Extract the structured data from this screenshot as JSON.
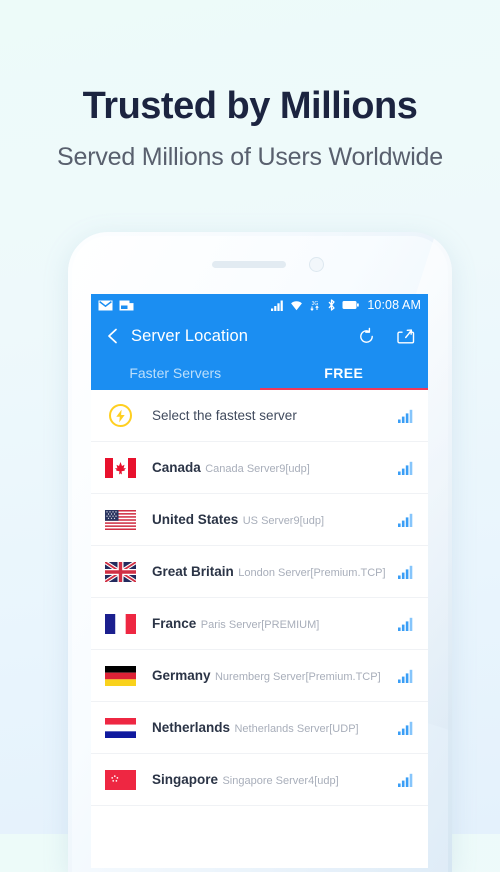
{
  "promo": {
    "title": "Trusted by Millions",
    "subtitle": "Served Millions of Users Worldwide"
  },
  "colors": {
    "accent": "#1b8ef2",
    "tab_underline": "#f0395a",
    "bolt": "#ffcf20",
    "signal": "#2b95f5",
    "title_text": "#1c2440",
    "subtitle_text": "#59606e"
  },
  "statusbar": {
    "time": "10:08 AM",
    "left_icons": [
      "mail-icon",
      "mail-read-icon"
    ],
    "right_icons": [
      "cell-signal-icon",
      "wifi-icon",
      "3g-icon",
      "bluetooth-icon",
      "battery-icon"
    ],
    "network_label": "3G"
  },
  "appbar": {
    "back_icon": "back-chevron-icon",
    "title": "Server Location",
    "refresh_icon": "refresh-icon",
    "share_icon": "share-icon"
  },
  "tabs": [
    {
      "label": "Faster Servers",
      "active": false
    },
    {
      "label": "FREE",
      "active": true
    }
  ],
  "fastest_row": {
    "label": "Select the fastest server",
    "icon": "lightning-bolt-icon",
    "signal": "signal-bars-icon"
  },
  "servers": [
    {
      "country": "Canada",
      "server": "Canada Server9[udp]",
      "flag": "flag-ca"
    },
    {
      "country": "United States",
      "server": "US Server9[udp]",
      "flag": "flag-us"
    },
    {
      "country": "Great Britain",
      "server": "London Server[Premium.TCP]",
      "flag": "flag-gb"
    },
    {
      "country": "France",
      "server": "Paris Server[PREMIUM]",
      "flag": "flag-fr"
    },
    {
      "country": "Germany",
      "server": "Nuremberg Server[Premium.TCP]",
      "flag": "flag-de"
    },
    {
      "country": "Netherlands",
      "server": "Netherlands Server[UDP]",
      "flag": "flag-nl"
    },
    {
      "country": "Singapore",
      "server": "Singapore Server4[udp]",
      "flag": "flag-sg"
    }
  ]
}
